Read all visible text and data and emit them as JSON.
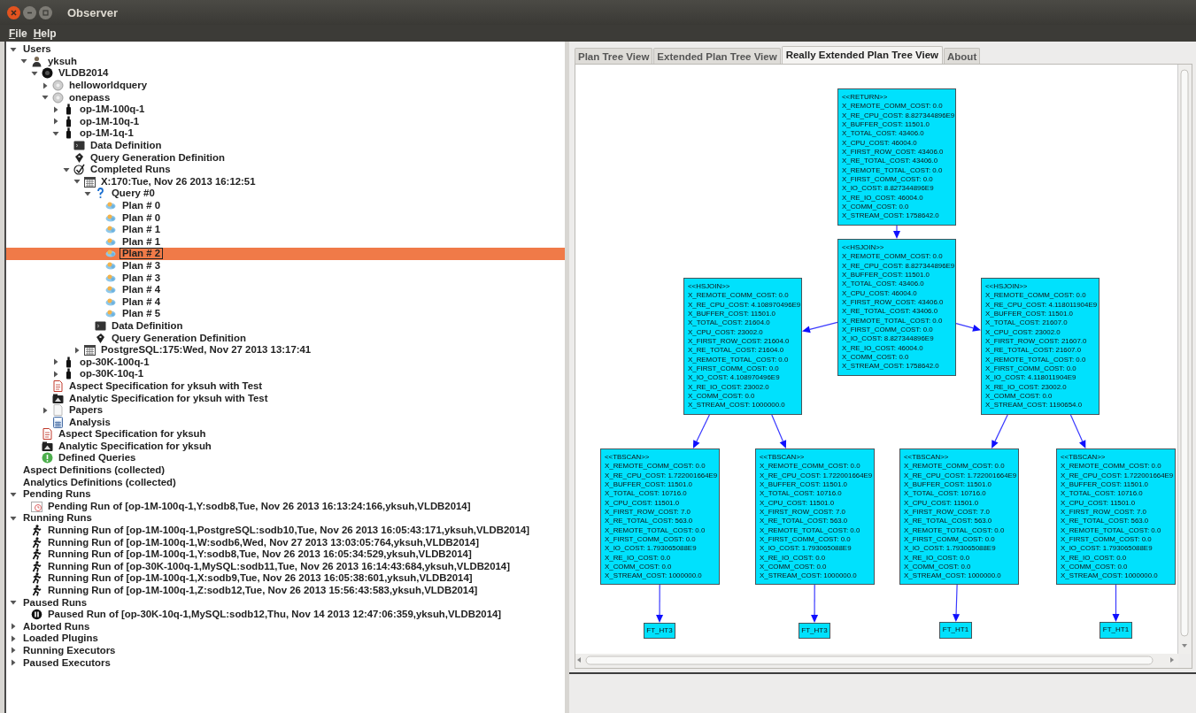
{
  "window": {
    "title": "Observer"
  },
  "menu": [
    "File",
    "Help"
  ],
  "tree": [
    {
      "label": "Users",
      "expanded": true,
      "selected": false,
      "children": [
        {
          "label": "yksuh",
          "kind": "user",
          "expanded": true,
          "selected": false,
          "children": [
            {
              "label": "VLDB2014",
              "kind": "db",
              "expanded": true,
              "selected": false,
              "children": [
                {
                  "label": "helloworldquery",
                  "kind": "query",
                  "expanded": false,
                  "selected": false
                },
                {
                  "label": "onepass",
                  "kind": "query",
                  "expanded": true,
                  "selected": false,
                  "children": [
                    {
                      "label": "op-1M-100q-1",
                      "kind": "bottle",
                      "expanded": false,
                      "selected": false
                    },
                    {
                      "label": "op-1M-10q-1",
                      "kind": "bottle",
                      "expanded": false,
                      "selected": false
                    },
                    {
                      "label": "op-1M-1q-1",
                      "kind": "bottle",
                      "expanded": true,
                      "selected": false,
                      "children": [
                        {
                          "label": "Data Definition",
                          "kind": "datadef",
                          "selected": false
                        },
                        {
                          "label": "Query Generation Definition",
                          "kind": "querygen",
                          "selected": false
                        },
                        {
                          "label": "Completed Runs",
                          "kind": "check",
                          "expanded": true,
                          "selected": false,
                          "children": [
                            {
                              "label": "X:170:Tue, Nov 26 2013 16:12:51",
                              "kind": "calendar",
                              "expanded": true,
                              "selected": false,
                              "children": [
                                {
                                  "label": "Query #0",
                                  "kind": "question",
                                  "expanded": true,
                                  "selected": false,
                                  "children": [
                                    {
                                      "label": "Plan # 0",
                                      "kind": "plan",
                                      "selected": false
                                    },
                                    {
                                      "label": "Plan # 0",
                                      "kind": "plan",
                                      "selected": false
                                    },
                                    {
                                      "label": "Plan # 1",
                                      "kind": "plan",
                                      "selected": false
                                    },
                                    {
                                      "label": "Plan # 1",
                                      "kind": "plan",
                                      "selected": false
                                    },
                                    {
                                      "label": "Plan # 2",
                                      "kind": "plan",
                                      "selected": true
                                    },
                                    {
                                      "label": "Plan # 3",
                                      "kind": "plan",
                                      "selected": false
                                    },
                                    {
                                      "label": "Plan # 3",
                                      "kind": "plan",
                                      "selected": false
                                    },
                                    {
                                      "label": "Plan # 4",
                                      "kind": "plan",
                                      "selected": false
                                    },
                                    {
                                      "label": "Plan # 4",
                                      "kind": "plan",
                                      "selected": false
                                    },
                                    {
                                      "label": "Plan # 5",
                                      "kind": "plan",
                                      "selected": false
                                    }
                                  ]
                                },
                                {
                                  "label": "Data Definition",
                                  "kind": "datadef",
                                  "selected": false
                                },
                                {
                                  "label": "Query Generation Definition",
                                  "kind": "querygen",
                                  "selected": false
                                }
                              ]
                            },
                            {
                              "label": "PostgreSQL:175:Wed, Nov 27 2013 13:17:41",
                              "kind": "calendar",
                              "expanded": false,
                              "selected": false
                            }
                          ]
                        }
                      ]
                    },
                    {
                      "label": "op-30K-100q-1",
                      "kind": "bottle",
                      "expanded": false,
                      "selected": false
                    },
                    {
                      "label": "op-30K-10q-1",
                      "kind": "bottle",
                      "expanded": false,
                      "selected": false
                    }
                  ]
                },
                {
                  "label": "Aspect Specification for yksuh with Test",
                  "kind": "aspect",
                  "selected": false
                },
                {
                  "label": "Analytic Specification for yksuh with Test",
                  "kind": "analytic",
                  "selected": false
                },
                {
                  "label": "Papers",
                  "kind": "paper",
                  "expanded": false,
                  "selected": false
                },
                {
                  "label": "Analysis",
                  "kind": "calc",
                  "selected": false
                }
              ]
            },
            {
              "label": "Aspect Specification for yksuh",
              "kind": "aspect",
              "selected": false
            },
            {
              "label": "Analytic Specification for yksuh",
              "kind": "analytic",
              "selected": false
            },
            {
              "label": "Defined Queries",
              "kind": "defined",
              "selected": false
            }
          ]
        }
      ]
    },
    {
      "label": "Aspect Definitions (collected)",
      "selected": false
    },
    {
      "label": "Analytics Definitions (collected)",
      "selected": false
    },
    {
      "label": "Pending Runs",
      "expanded": true,
      "selected": false,
      "children": [
        {
          "label": "Pending Run of [op-1M-100q-1,Y:sodb8,Tue, Nov 26 2013 16:13:24:166,yksuh,VLDB2014]",
          "kind": "pending",
          "selected": false
        }
      ]
    },
    {
      "label": "Running Runs",
      "expanded": true,
      "selected": false,
      "children": [
        {
          "label": "Running Run of [op-1M-100q-1,PostgreSQL:sodb10,Tue, Nov 26 2013 16:05:43:171,yksuh,VLDB2014]",
          "kind": "running",
          "selected": false
        },
        {
          "label": "Running Run of [op-1M-100q-1,W:sodb6,Wed, Nov 27 2013 13:03:05:764,yksuh,VLDB2014]",
          "kind": "running",
          "selected": false
        },
        {
          "label": "Running Run of [op-1M-100q-1,Y:sodb8,Tue, Nov 26 2013 16:05:34:529,yksuh,VLDB2014]",
          "kind": "running",
          "selected": false
        },
        {
          "label": "Running Run of [op-30K-100q-1,MySQL:sodb11,Tue, Nov 26 2013 16:14:43:684,yksuh,VLDB2014]",
          "kind": "running",
          "selected": false
        },
        {
          "label": "Running Run of [op-1M-100q-1,X:sodb9,Tue, Nov 26 2013 16:05:38:601,yksuh,VLDB2014]",
          "kind": "running",
          "selected": false
        },
        {
          "label": "Running Run of [op-1M-100q-1,Z:sodb12,Tue, Nov 26 2013 15:56:43:583,yksuh,VLDB2014]",
          "kind": "running",
          "selected": false
        }
      ]
    },
    {
      "label": "Paused Runs",
      "expanded": true,
      "selected": false,
      "children": [
        {
          "label": "Paused Run of [op-30K-10q-1,MySQL:sodb12,Thu, Nov 14 2013 12:47:06:359,yksuh,VLDB2014]",
          "kind": "paused",
          "selected": false
        }
      ]
    },
    {
      "label": "Aborted Runs",
      "expanded": false,
      "selected": false
    },
    {
      "label": "Loaded Plugins",
      "expanded": false,
      "selected": false
    },
    {
      "label": "Running Executors",
      "expanded": false,
      "selected": false
    },
    {
      "label": "Paused Executors",
      "expanded": false,
      "selected": false
    }
  ],
  "tabs": [
    {
      "label": "Plan Tree View",
      "selected": false
    },
    {
      "label": "Extended Plan Tree View",
      "selected": false
    },
    {
      "label": "Really Extended Plan Tree View",
      "selected": true
    },
    {
      "label": "About",
      "selected": false
    }
  ],
  "plan_tree": {
    "title": "<<RETURN>>",
    "lines": [
      "X_REMOTE_COMM_COST: 0.0",
      "X_RE_CPU_COST: 8.827344896E9",
      "X_BUFFER_COST: 11501.0",
      "X_TOTAL_COST: 43406.0",
      "X_CPU_COST: 46004.0",
      "X_FIRST_ROW_COST: 43406.0",
      "X_RE_TOTAL_COST: 43406.0",
      "X_REMOTE_TOTAL_COST: 0.0",
      "X_FIRST_COMM_COST: 0.0",
      "X_IO_COST: 8.827344896E9",
      "X_RE_IO_COST: 46004.0",
      "X_COMM_COST: 0.0",
      "X_STREAM_COST: 1758642.0"
    ],
    "children": [
      {
        "title": "<<HSJOIN>>",
        "lines": [
          "X_REMOTE_COMM_COST: 0.0",
          "X_RE_CPU_COST: 8.827344896E9",
          "X_BUFFER_COST: 11501.0",
          "X_TOTAL_COST: 43406.0",
          "X_CPU_COST: 46004.0",
          "X_FIRST_ROW_COST: 43406.0",
          "X_RE_TOTAL_COST: 43406.0",
          "X_REMOTE_TOTAL_COST: 0.0",
          "X_FIRST_COMM_COST: 0.0",
          "X_IO_COST: 8.827344896E9",
          "X_RE_IO_COST: 46004.0",
          "X_COMM_COST: 0.0",
          "X_STREAM_COST: 1758642.0"
        ],
        "children": [
          {
            "title": "<<HSJOIN>>",
            "lines": [
              "X_REMOTE_COMM_COST: 0.0",
              "X_RE_CPU_COST: 4.108970496E9",
              "X_BUFFER_COST: 11501.0",
              "X_TOTAL_COST: 21604.0",
              "X_CPU_COST: 23002.0",
              "X_FIRST_ROW_COST: 21604.0",
              "X_RE_TOTAL_COST: 21604.0",
              "X_REMOTE_TOTAL_COST: 0.0",
              "X_FIRST_COMM_COST: 0.0",
              "X_IO_COST: 4.108970496E9",
              "X_RE_IO_COST: 23002.0",
              "X_COMM_COST: 0.0",
              "X_STREAM_COST: 1000000.0"
            ],
            "children": [
              {
                "title": "<<TBSCAN>>",
                "lines": [
                  "X_REMOTE_COMM_COST: 0.0",
                  "X_RE_CPU_COST: 1.722001664E9",
                  "X_BUFFER_COST: 11501.0",
                  "X_TOTAL_COST: 10716.0",
                  "X_CPU_COST: 11501.0",
                  "X_FIRST_ROW_COST: 7.0",
                  "X_RE_TOTAL_COST: 563.0",
                  "X_REMOTE_TOTAL_COST: 0.0",
                  "X_FIRST_COMM_COST: 0.0",
                  "X_IO_COST: 1.793065088E9",
                  "X_RE_IO_COST: 0.0",
                  "X_COMM_COST: 0.0",
                  "X_STREAM_COST: 1000000.0"
                ],
                "children": [
                  {
                    "title": "FT_HT3"
                  }
                ]
              },
              {
                "title": "<<TBSCAN>>",
                "lines": [
                  "X_REMOTE_COMM_COST: 0.0",
                  "X_RE_CPU_COST: 1.722001664E9",
                  "X_BUFFER_COST: 11501.0",
                  "X_TOTAL_COST: 10716.0",
                  "X_CPU_COST: 11501.0",
                  "X_FIRST_ROW_COST: 7.0",
                  "X_RE_TOTAL_COST: 563.0",
                  "X_REMOTE_TOTAL_COST: 0.0",
                  "X_FIRST_COMM_COST: 0.0",
                  "X_IO_COST: 1.793065088E9",
                  "X_RE_IO_COST: 0.0",
                  "X_COMM_COST: 0.0",
                  "X_STREAM_COST: 1000000.0"
                ],
                "children": [
                  {
                    "title": "FT_HT3"
                  }
                ]
              }
            ]
          },
          {
            "title": "<<HSJOIN>>",
            "lines": [
              "X_REMOTE_COMM_COST: 0.0",
              "X_RE_CPU_COST: 4.118011904E9",
              "X_BUFFER_COST: 11501.0",
              "X_TOTAL_COST: 21607.0",
              "X_CPU_COST: 23002.0",
              "X_FIRST_ROW_COST: 21607.0",
              "X_RE_TOTAL_COST: 21607.0",
              "X_REMOTE_TOTAL_COST: 0.0",
              "X_FIRST_COMM_COST: 0.0",
              "X_IO_COST: 4.118011904E9",
              "X_RE_IO_COST: 23002.0",
              "X_COMM_COST: 0.0",
              "X_STREAM_COST: 1190654.0"
            ],
            "children": [
              {
                "title": "<<TBSCAN>>",
                "lines": [
                  "X_REMOTE_COMM_COST: 0.0",
                  "X_RE_CPU_COST: 1.722001664E9",
                  "X_BUFFER_COST: 11501.0",
                  "X_TOTAL_COST: 10716.0",
                  "X_CPU_COST: 11501.0",
                  "X_FIRST_ROW_COST: 7.0",
                  "X_RE_TOTAL_COST: 563.0",
                  "X_REMOTE_TOTAL_COST: 0.0",
                  "X_FIRST_COMM_COST: 0.0",
                  "X_IO_COST: 1.793065088E9",
                  "X_RE_IO_COST: 0.0",
                  "X_COMM_COST: 0.0",
                  "X_STREAM_COST: 1000000.0"
                ],
                "children": [
                  {
                    "title": "FT_HT1"
                  }
                ]
              },
              {
                "title": "<<TBSCAN>>",
                "lines": [
                  "X_REMOTE_COMM_COST: 0.0",
                  "X_RE_CPU_COST: 1.722001664E9",
                  "X_BUFFER_COST: 11501.0",
                  "X_TOTAL_COST: 10716.0",
                  "X_CPU_COST: 11501.0",
                  "X_FIRST_ROW_COST: 7.0",
                  "X_RE_TOTAL_COST: 563.0",
                  "X_REMOTE_TOTAL_COST: 0.0",
                  "X_FIRST_COMM_COST: 0.0",
                  "X_IO_COST: 1.793065088E9",
                  "X_RE_IO_COST: 0.0",
                  "X_COMM_COST: 0.0",
                  "X_STREAM_COST: 1000000.0"
                ],
                "children": [
                  {
                    "title": "FT_HT1"
                  }
                ]
              }
            ]
          }
        ]
      }
    ]
  }
}
